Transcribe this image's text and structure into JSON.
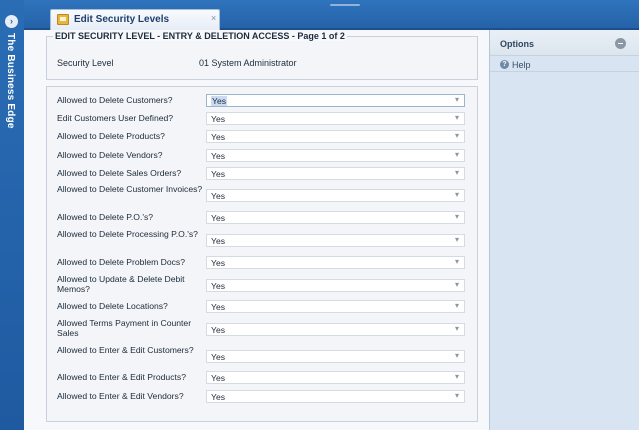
{
  "sidebar": {
    "title": "The Business Edge",
    "toggle_icon": "chevron-right-icon"
  },
  "tab": {
    "label": "Edit Security Levels",
    "close": "×",
    "icon": "folder-icon"
  },
  "header": {
    "title": "EDIT SECURITY LEVEL - ENTRY & DELETION ACCESS - Page 1 of 2",
    "security_level_label": "Security Level",
    "security_level_value": "01 System Administrator"
  },
  "form": {
    "rows": [
      {
        "label": "Allowed to Delete Customers?",
        "value": "Yes"
      },
      {
        "label": "Edit Customers User Defined?",
        "value": "Yes"
      },
      {
        "label": "Allowed to Delete Products?",
        "value": "Yes"
      },
      {
        "label": "Allowed to Delete Vendors?",
        "value": "Yes"
      },
      {
        "label": "Allowed to Delete Sales Orders?",
        "value": "Yes"
      },
      {
        "label": "Allowed to Delete Customer Invoices?",
        "value": "Yes"
      },
      {
        "label": "Allowed to Delete P.O.'s?",
        "value": "Yes"
      },
      {
        "label": "Allowed to Delete Processing P.O.'s?",
        "value": "Yes"
      },
      {
        "label": "Allowed to Delete Problem Docs?",
        "value": "Yes"
      },
      {
        "label": "Allowed to Update & Delete Debit Memos?",
        "value": "Yes"
      },
      {
        "label": "Allowed to Delete Locations?",
        "value": "Yes"
      },
      {
        "label": "Allowed Terms Payment in Counter Sales",
        "value": "Yes"
      },
      {
        "label": "Allowed to Enter & Edit Customers?",
        "value": "Yes"
      },
      {
        "label": "Allowed to Enter & Edit Products?",
        "value": "Yes"
      },
      {
        "label": "Allowed to Enter & Edit Vendors?",
        "value": "Yes"
      }
    ]
  },
  "options": {
    "title": "Options",
    "help_label": "Help"
  },
  "colors": {
    "accent": "#2a6db5",
    "panel": "#d8e4f1",
    "selected": "#c9daf1"
  }
}
